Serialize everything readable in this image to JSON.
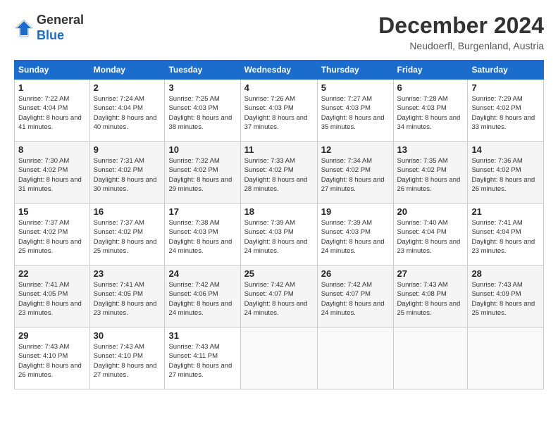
{
  "logo": {
    "general": "General",
    "blue": "Blue"
  },
  "title": "December 2024",
  "subtitle": "Neudoerfl, Burgenland, Austria",
  "days_of_week": [
    "Sunday",
    "Monday",
    "Tuesday",
    "Wednesday",
    "Thursday",
    "Friday",
    "Saturday"
  ],
  "weeks": [
    [
      {
        "day": "1",
        "sunrise": "7:22 AM",
        "sunset": "4:04 PM",
        "daylight": "8 hours and 41 minutes."
      },
      {
        "day": "2",
        "sunrise": "7:24 AM",
        "sunset": "4:04 PM",
        "daylight": "8 hours and 40 minutes."
      },
      {
        "day": "3",
        "sunrise": "7:25 AM",
        "sunset": "4:03 PM",
        "daylight": "8 hours and 38 minutes."
      },
      {
        "day": "4",
        "sunrise": "7:26 AM",
        "sunset": "4:03 PM",
        "daylight": "8 hours and 37 minutes."
      },
      {
        "day": "5",
        "sunrise": "7:27 AM",
        "sunset": "4:03 PM",
        "daylight": "8 hours and 35 minutes."
      },
      {
        "day": "6",
        "sunrise": "7:28 AM",
        "sunset": "4:03 PM",
        "daylight": "8 hours and 34 minutes."
      },
      {
        "day": "7",
        "sunrise": "7:29 AM",
        "sunset": "4:02 PM",
        "daylight": "8 hours and 33 minutes."
      }
    ],
    [
      {
        "day": "8",
        "sunrise": "7:30 AM",
        "sunset": "4:02 PM",
        "daylight": "8 hours and 31 minutes."
      },
      {
        "day": "9",
        "sunrise": "7:31 AM",
        "sunset": "4:02 PM",
        "daylight": "8 hours and 30 minutes."
      },
      {
        "day": "10",
        "sunrise": "7:32 AM",
        "sunset": "4:02 PM",
        "daylight": "8 hours and 29 minutes."
      },
      {
        "day": "11",
        "sunrise": "7:33 AM",
        "sunset": "4:02 PM",
        "daylight": "8 hours and 28 minutes."
      },
      {
        "day": "12",
        "sunrise": "7:34 AM",
        "sunset": "4:02 PM",
        "daylight": "8 hours and 27 minutes."
      },
      {
        "day": "13",
        "sunrise": "7:35 AM",
        "sunset": "4:02 PM",
        "daylight": "8 hours and 26 minutes."
      },
      {
        "day": "14",
        "sunrise": "7:36 AM",
        "sunset": "4:02 PM",
        "daylight": "8 hours and 26 minutes."
      }
    ],
    [
      {
        "day": "15",
        "sunrise": "7:37 AM",
        "sunset": "4:02 PM",
        "daylight": "8 hours and 25 minutes."
      },
      {
        "day": "16",
        "sunrise": "7:37 AM",
        "sunset": "4:02 PM",
        "daylight": "8 hours and 25 minutes."
      },
      {
        "day": "17",
        "sunrise": "7:38 AM",
        "sunset": "4:03 PM",
        "daylight": "8 hours and 24 minutes."
      },
      {
        "day": "18",
        "sunrise": "7:39 AM",
        "sunset": "4:03 PM",
        "daylight": "8 hours and 24 minutes."
      },
      {
        "day": "19",
        "sunrise": "7:39 AM",
        "sunset": "4:03 PM",
        "daylight": "8 hours and 24 minutes."
      },
      {
        "day": "20",
        "sunrise": "7:40 AM",
        "sunset": "4:04 PM",
        "daylight": "8 hours and 23 minutes."
      },
      {
        "day": "21",
        "sunrise": "7:41 AM",
        "sunset": "4:04 PM",
        "daylight": "8 hours and 23 minutes."
      }
    ],
    [
      {
        "day": "22",
        "sunrise": "7:41 AM",
        "sunset": "4:05 PM",
        "daylight": "8 hours and 23 minutes."
      },
      {
        "day": "23",
        "sunrise": "7:41 AM",
        "sunset": "4:05 PM",
        "daylight": "8 hours and 23 minutes."
      },
      {
        "day": "24",
        "sunrise": "7:42 AM",
        "sunset": "4:06 PM",
        "daylight": "8 hours and 24 minutes."
      },
      {
        "day": "25",
        "sunrise": "7:42 AM",
        "sunset": "4:07 PM",
        "daylight": "8 hours and 24 minutes."
      },
      {
        "day": "26",
        "sunrise": "7:42 AM",
        "sunset": "4:07 PM",
        "daylight": "8 hours and 24 minutes."
      },
      {
        "day": "27",
        "sunrise": "7:43 AM",
        "sunset": "4:08 PM",
        "daylight": "8 hours and 25 minutes."
      },
      {
        "day": "28",
        "sunrise": "7:43 AM",
        "sunset": "4:09 PM",
        "daylight": "8 hours and 25 minutes."
      }
    ],
    [
      {
        "day": "29",
        "sunrise": "7:43 AM",
        "sunset": "4:10 PM",
        "daylight": "8 hours and 26 minutes."
      },
      {
        "day": "30",
        "sunrise": "7:43 AM",
        "sunset": "4:10 PM",
        "daylight": "8 hours and 27 minutes."
      },
      {
        "day": "31",
        "sunrise": "7:43 AM",
        "sunset": "4:11 PM",
        "daylight": "8 hours and 27 minutes."
      },
      null,
      null,
      null,
      null
    ]
  ],
  "labels": {
    "sunrise": "Sunrise:",
    "sunset": "Sunset:",
    "daylight": "Daylight:"
  }
}
